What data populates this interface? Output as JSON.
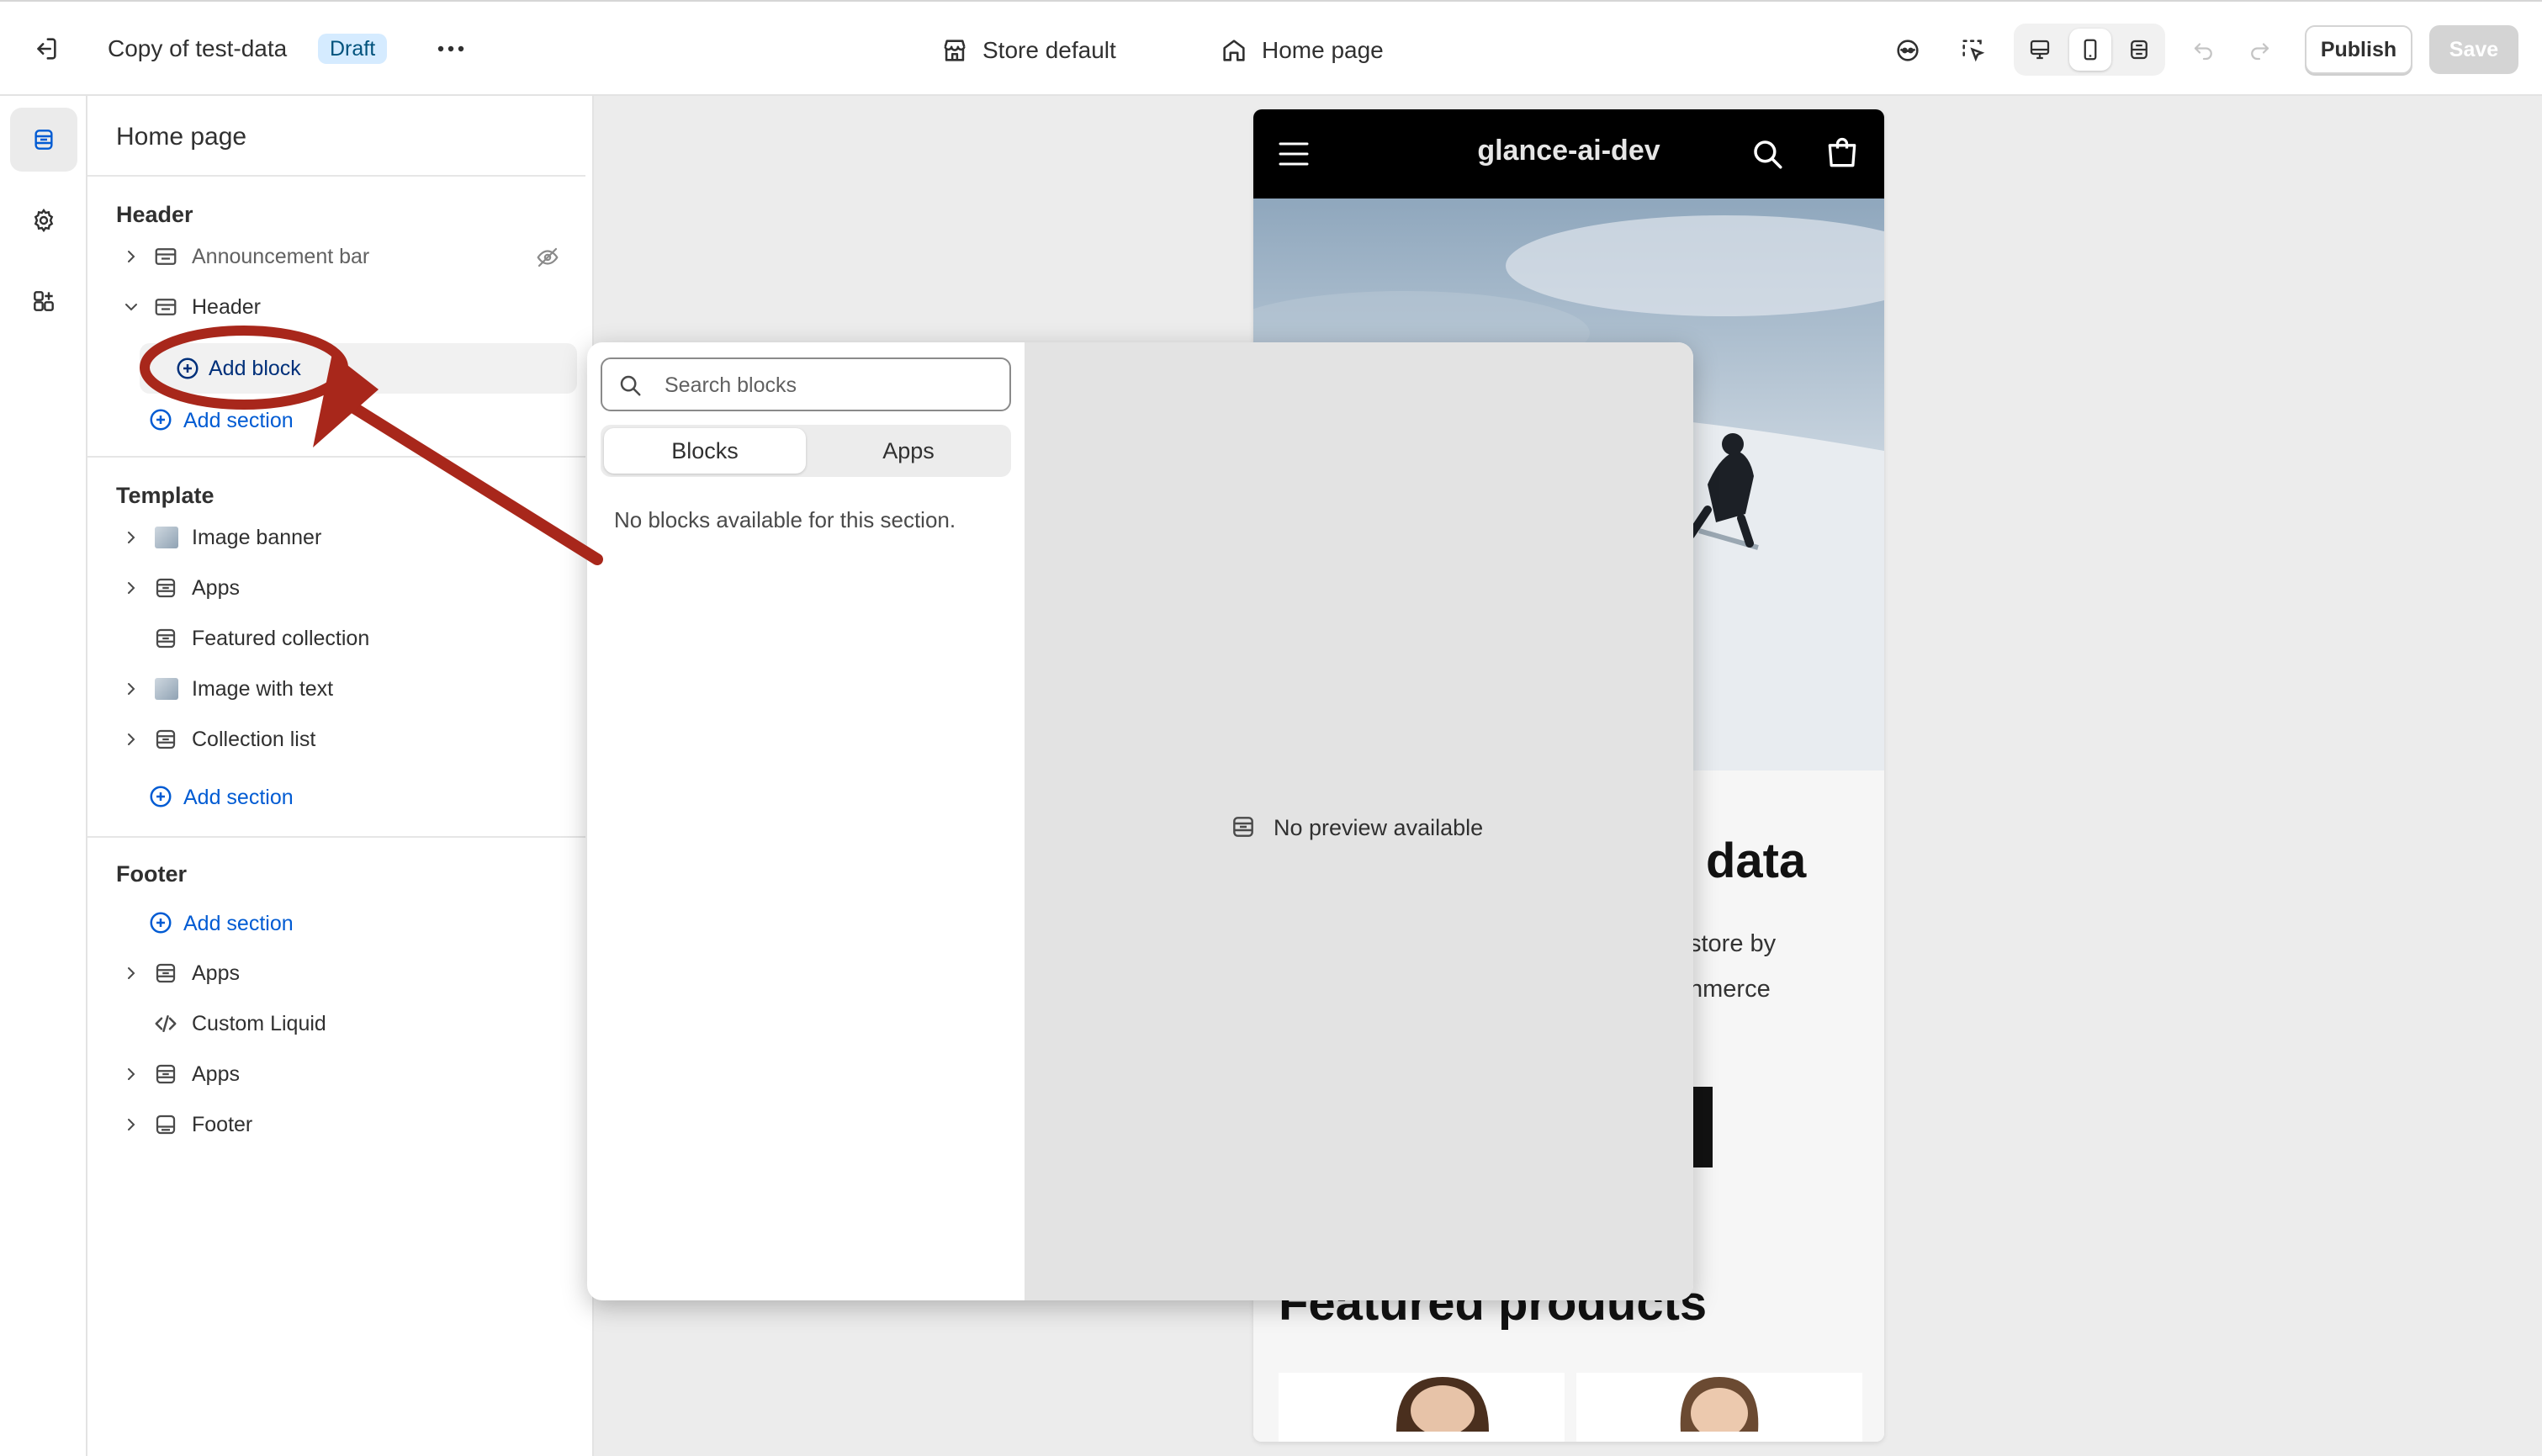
{
  "topbar": {
    "theme_name": "Copy of test-data",
    "status_badge": "Draft",
    "store_selector": "Store default",
    "page_selector": "Home page",
    "publish_label": "Publish",
    "save_label": "Save"
  },
  "sidebar": {
    "title": "Home page",
    "header_group": {
      "heading": "Header",
      "items": [
        {
          "label": "Announcement bar",
          "icon": "section-icon",
          "hidden": true
        },
        {
          "label": "Header",
          "icon": "section-icon",
          "expanded": true
        }
      ],
      "add_block": "Add block",
      "add_section": "Add section"
    },
    "template_group": {
      "heading": "Template",
      "items": [
        {
          "label": "Image banner",
          "icon": "image-icon"
        },
        {
          "label": "Apps",
          "icon": "apps-section-icon"
        },
        {
          "label": "Featured collection",
          "icon": "apps-section-icon"
        },
        {
          "label": "Image with text",
          "icon": "image-icon"
        },
        {
          "label": "Collection list",
          "icon": "apps-section-icon"
        }
      ],
      "add_section": "Add section"
    },
    "footer_group": {
      "heading": "Footer",
      "add_section": "Add section",
      "items": [
        {
          "label": "Apps",
          "icon": "apps-section-icon"
        },
        {
          "label": "Custom Liquid",
          "icon": "code-icon"
        },
        {
          "label": "Apps",
          "icon": "apps-section-icon"
        },
        {
          "label": "Footer",
          "icon": "footer-section-icon"
        }
      ]
    }
  },
  "popup": {
    "search_placeholder": "Search blocks",
    "tabs": [
      "Blocks",
      "Apps"
    ],
    "active_tab": "Blocks",
    "empty_message": "No blocks available for this section.",
    "preview_message": "No preview available"
  },
  "preview": {
    "store_name": "glance-ai-dev",
    "heading_fragment": "data",
    "body_line1": "store by",
    "body_line2": "nmerce",
    "featured_heading": "Featured products"
  },
  "annotation": {
    "color": "#a8271b"
  },
  "colors": {
    "accent": "#005bd3",
    "badge_bg": "#d5ebff",
    "badge_text": "#00527c"
  }
}
